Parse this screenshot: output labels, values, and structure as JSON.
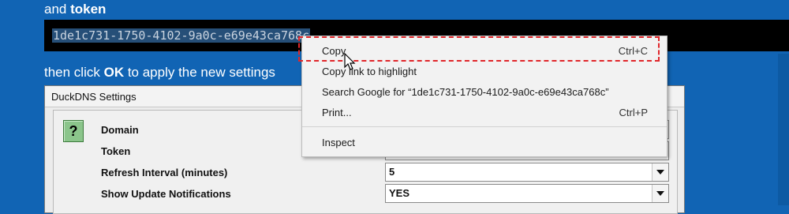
{
  "header": {
    "line_prefix": "and ",
    "line_bold": "token"
  },
  "token_value": "1de1c731-1750-4102-9a0c-e69e43ca768c",
  "instruction": {
    "prefix": "then click ",
    "bold": "OK",
    "suffix": " to apply the new settings"
  },
  "dialog": {
    "title": "DuckDNS Settings",
    "fields": {
      "domain_label": "Domain",
      "token_label": "Token",
      "refresh_label": "Refresh Interval (minutes)",
      "refresh_value": "5",
      "notify_label": "Show Update Notifications",
      "notify_value": "YES"
    }
  },
  "context_menu": {
    "items": [
      {
        "label": "Copy",
        "shortcut": "Ctrl+C"
      },
      {
        "label": "Copy link to highlight",
        "shortcut": ""
      },
      {
        "label": "Search Google for “1de1c731-1750-4102-9a0c-e69e43ca768c”",
        "shortcut": ""
      },
      {
        "label": "Print...",
        "shortcut": "Ctrl+P"
      },
      {
        "label": "Inspect",
        "shortcut": ""
      }
    ]
  },
  "colors": {
    "background": "#1164b4",
    "highlight_border": "#e0262a",
    "selection": "#264f78"
  },
  "icons": {
    "help": "help-question-icon",
    "cursor": "mouse-pointer-icon"
  }
}
